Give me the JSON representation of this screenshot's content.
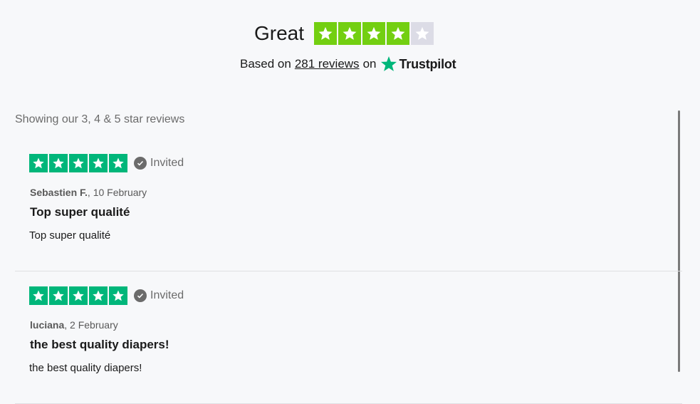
{
  "summary": {
    "rating_word": "Great",
    "stars_filled": 4,
    "stars_total": 5,
    "based_prefix": "Based on",
    "review_count_link": "281 reviews",
    "based_suffix": "on",
    "brand": "Trustpilot"
  },
  "colors": {
    "header_star_green": "#73cf11",
    "header_star_empty": "#dcdce6",
    "review_star_green": "#00b67a",
    "brand_star": "#00b67a"
  },
  "filter_text": "Showing our 3, 4 & 5 star reviews",
  "reviews": [
    {
      "stars": 5,
      "badge": "Invited",
      "author": "Sebastien F.",
      "date": ", 10 February",
      "title": "Top super qualité",
      "body": "Top super qualité"
    },
    {
      "stars": 5,
      "badge": "Invited",
      "author": "luciana",
      "date": ", 2 February",
      "title": "the best quality diapers!",
      "body": "the best quality diapers!"
    }
  ]
}
